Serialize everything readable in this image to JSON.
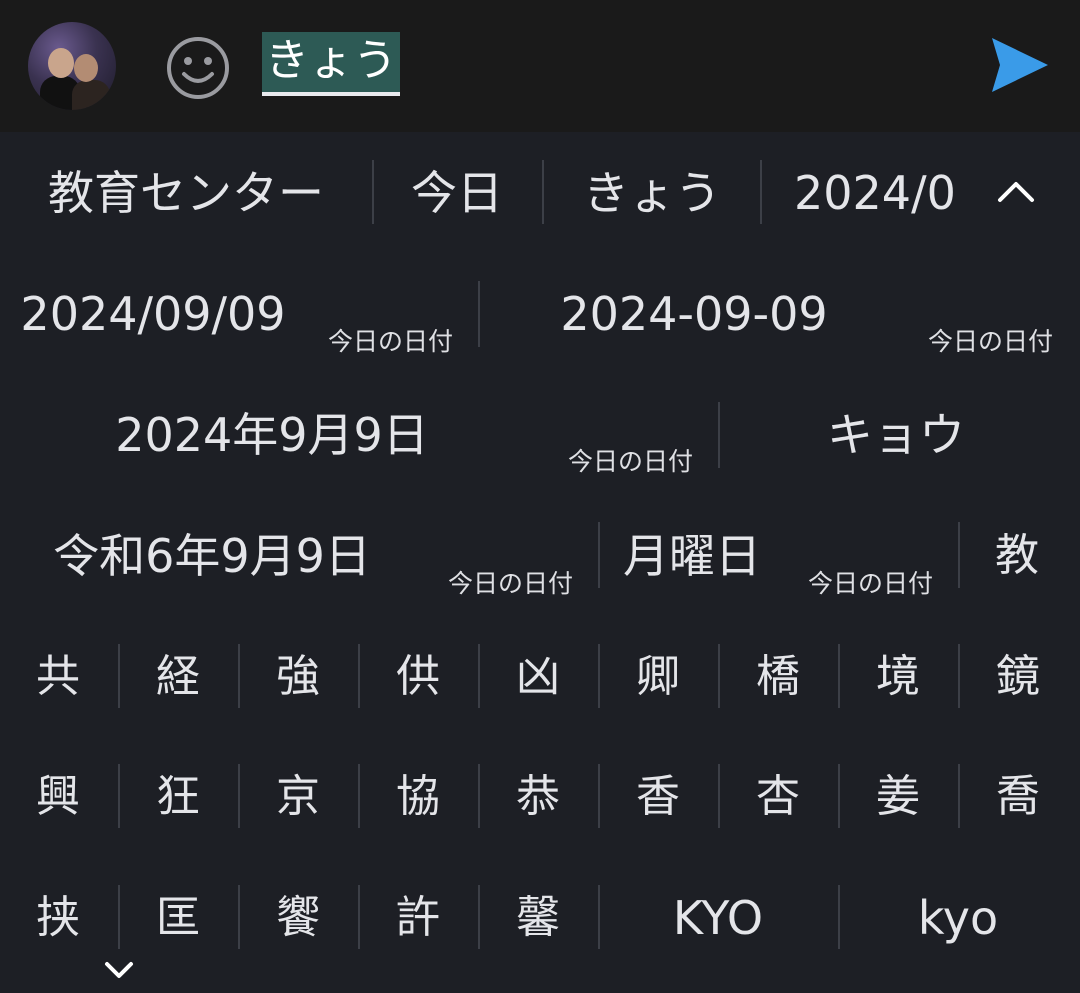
{
  "composer": {
    "text": "きょう",
    "avatar_icon": "avatar",
    "emoji_icon": "emoji-icon",
    "send_icon": "send-icon",
    "accent": "#3a9be8",
    "highlight": "#2d5a55"
  },
  "suggestions": {
    "strip": [
      "教育センター",
      "今日",
      "きょう",
      "2024/0"
    ],
    "expand_icon": "chevron-up-icon"
  },
  "candidates": {
    "dates": [
      {
        "value": "2024/09/09",
        "note": "今日の日付"
      },
      {
        "value": "2024-09-09",
        "note": "今日の日付"
      },
      {
        "value": "2024年9月9日",
        "note": "今日の日付"
      },
      {
        "value": "キョウ",
        "note": ""
      },
      {
        "value": "令和6年9月9日",
        "note": "今日の日付"
      },
      {
        "value": "月曜日",
        "note": "今日の日付"
      },
      {
        "value": "教",
        "note": ""
      }
    ],
    "row1": [
      "共",
      "経",
      "強",
      "供",
      "凶",
      "卿",
      "橋",
      "境",
      "鏡"
    ],
    "row2": [
      "興",
      "狂",
      "京",
      "協",
      "恭",
      "香",
      "杏",
      "姜",
      "喬"
    ],
    "row3": [
      "挟",
      "匡",
      "饗",
      "許",
      "馨",
      "KYO",
      "kyo"
    ],
    "collapse_icon": "chevron-down-icon"
  }
}
